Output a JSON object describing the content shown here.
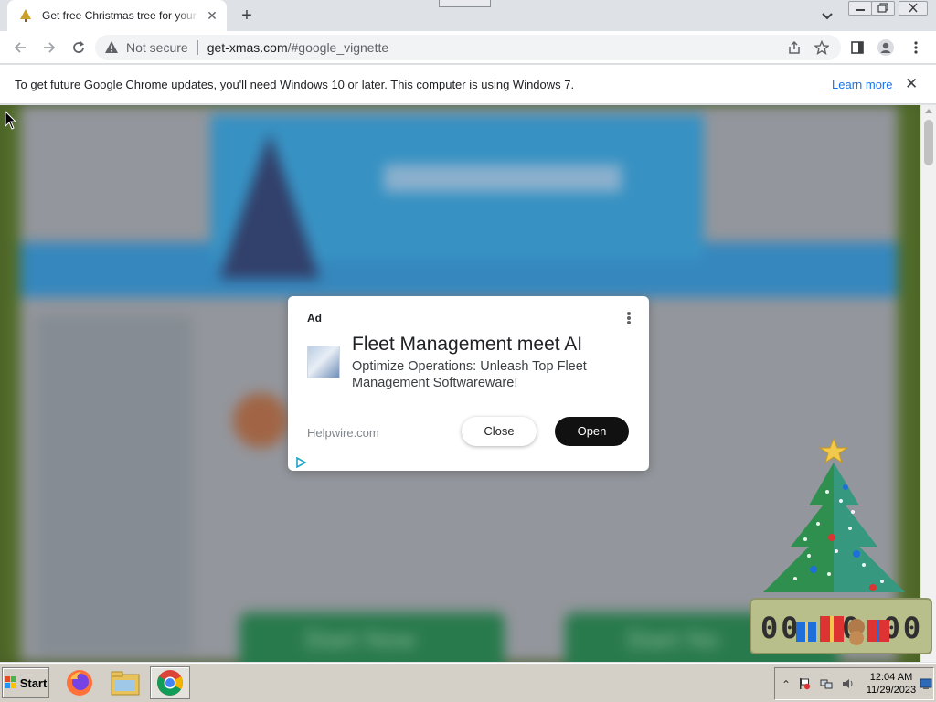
{
  "browser": {
    "tab": {
      "title": "Get free Christmas tree for your desktop",
      "favicon": "christmas-tree-icon"
    },
    "window_controls": [
      "minimize",
      "restore",
      "close"
    ],
    "address_bar": {
      "security_label": "Not secure",
      "url_host": "get-xmas.com",
      "url_rest": "/#google_vignette"
    }
  },
  "infobar": {
    "message": "To get future Google Chrome updates, you'll need Windows 10 or later. This computer is using Windows 7.",
    "link": "Learn more"
  },
  "ad": {
    "label": "Ad",
    "headline": "Fleet Management meet AI",
    "description": "Optimize Operations: Unleash Top Fleet Management Softwareware!",
    "domain": "Helpwire.com",
    "close_label": "Close",
    "open_label": "Open"
  },
  "background_page": {
    "button_left": "Start Now",
    "button_right": "Start No"
  },
  "tree_widget": {
    "clock_digits": "00:00:00"
  },
  "taskbar": {
    "start_label": "Start",
    "apps": [
      "firefox",
      "file-explorer",
      "chrome"
    ],
    "time": "12:04 AM",
    "date": "11/29/2023"
  },
  "colors": {
    "accent_link": "#1a73e8",
    "ad_open_button": "#111111",
    "page_backdrop": "#5c7a2e"
  }
}
